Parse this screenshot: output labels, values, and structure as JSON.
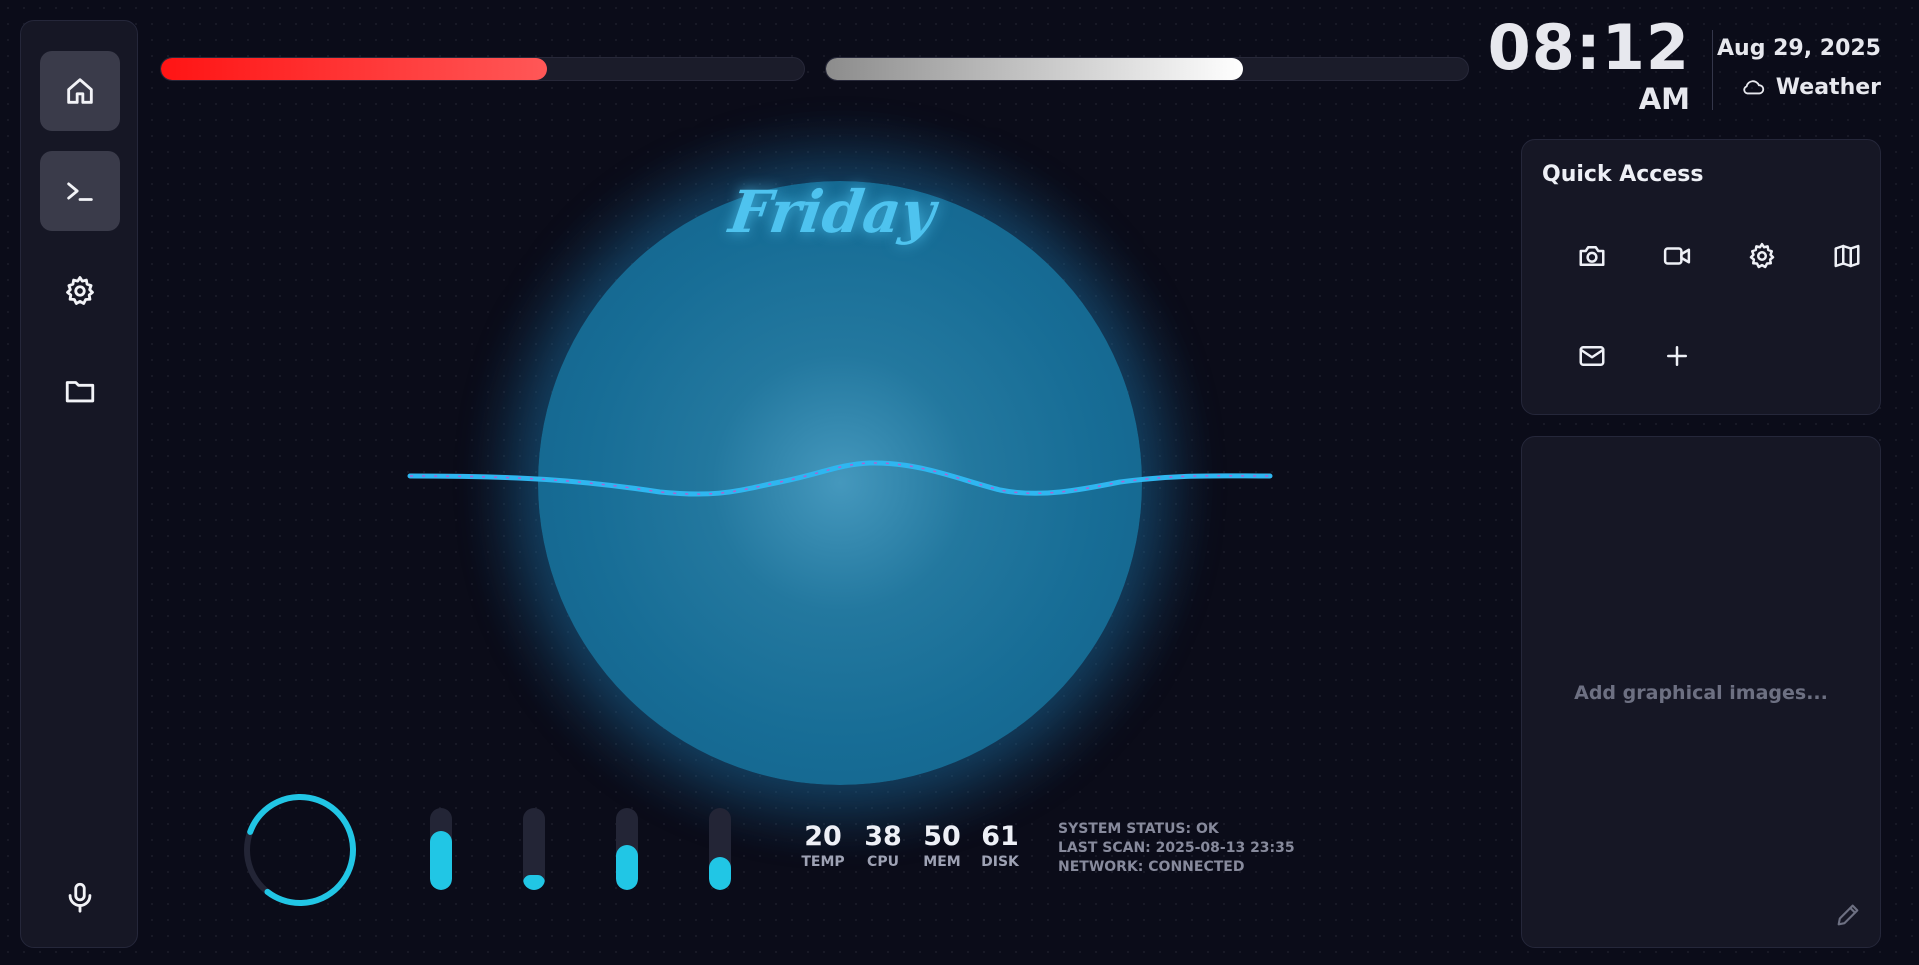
{
  "sidebar": {
    "items": [
      {
        "name": "home",
        "icon": "home-icon",
        "active": true
      },
      {
        "name": "terminal",
        "icon": "terminal-icon",
        "active": true
      },
      {
        "name": "settings",
        "icon": "gear-icon",
        "active": false
      },
      {
        "name": "files",
        "icon": "folder-icon",
        "active": false
      }
    ],
    "mic_icon": "microphone-icon"
  },
  "progress_bars": [
    {
      "name": "red-bar",
      "fraction": 0.6,
      "color": "#ff3b3b"
    },
    {
      "name": "white-bar",
      "fraction": 0.65,
      "color": "#ffffff"
    }
  ],
  "clock": {
    "time": "08:12",
    "ampm": "AM",
    "date": "Aug 29, 2025",
    "weather_label": "Weather",
    "weather_icon": "cloud-icon"
  },
  "orb": {
    "title": "Friday"
  },
  "ring": {
    "color": "#21c6e5"
  },
  "vertical_bars": [
    {
      "name": "bar-1",
      "fraction": 0.72
    },
    {
      "name": "bar-2",
      "fraction": 0.18
    },
    {
      "name": "bar-3",
      "fraction": 0.55
    },
    {
      "name": "bar-4",
      "fraction": 0.4
    }
  ],
  "stats": [
    {
      "value": "20",
      "label": "TEMP"
    },
    {
      "value": "38",
      "label": "CPU"
    },
    {
      "value": "50",
      "label": "MEM"
    },
    {
      "value": "61",
      "label": "DISK"
    }
  ],
  "system": {
    "status": "SYSTEM STATUS: OK",
    "last_scan": "LAST SCAN: 2025-08-13 23:35",
    "network": "NETWORK: CONNECTED"
  },
  "quick_access": {
    "title": "Quick Access",
    "items": [
      "camera-icon",
      "video-icon",
      "gear-icon",
      "map-icon",
      "mail-icon",
      "plus-icon"
    ]
  },
  "graphics_panel": {
    "placeholder": "Add graphical images..."
  },
  "colors": {
    "accent": "#21c6e5",
    "background": "#0b0c19",
    "panel": "#161725"
  }
}
